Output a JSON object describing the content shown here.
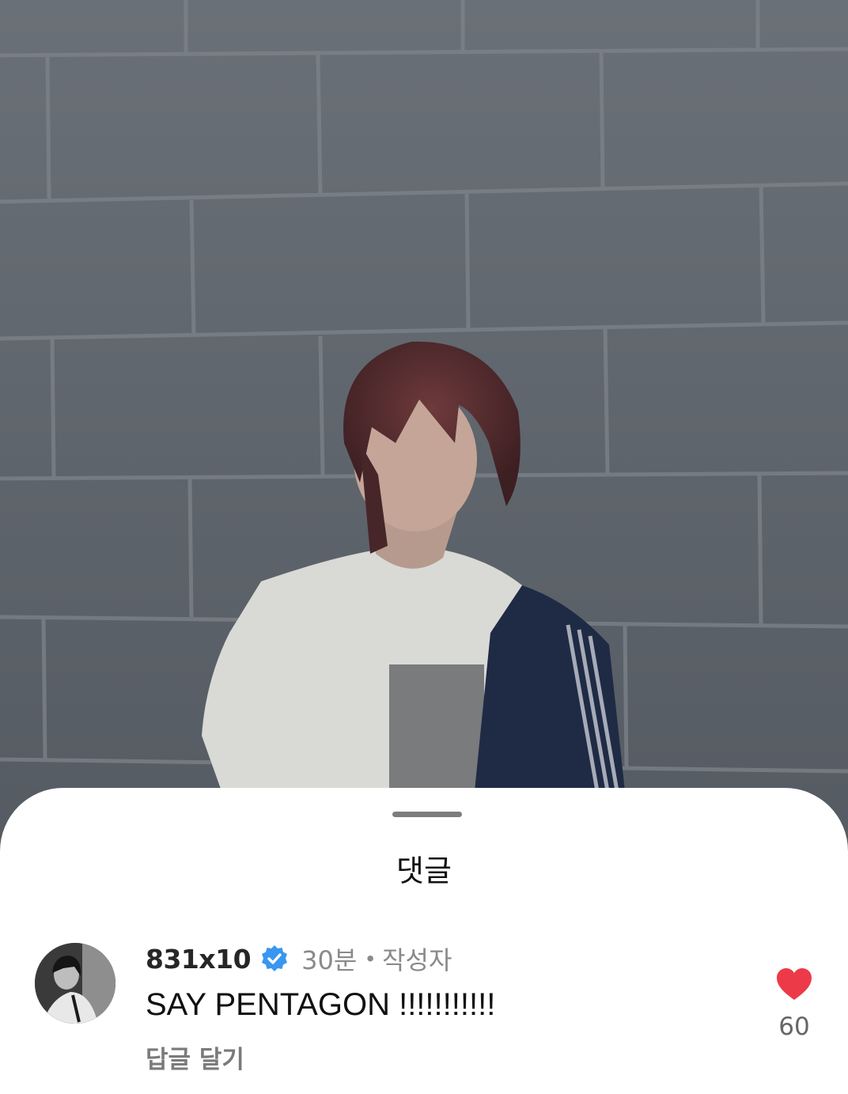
{
  "comments_sheet": {
    "title": "댓글"
  },
  "comment": {
    "username": "831x10",
    "verified_icon": "verified-badge-icon",
    "time": "30분",
    "separator": "•",
    "author_label": "작성자",
    "text": "SAY PENTAGON !!!!!!!!!!!",
    "reply_label": "답글 달기",
    "like_icon": "heart-icon",
    "like_count": "60",
    "liked": true
  },
  "colors": {
    "verified": "#3897f0",
    "heart": "#ed3a49",
    "sheet_background": "#ffffff",
    "wall": "#5b6168"
  }
}
